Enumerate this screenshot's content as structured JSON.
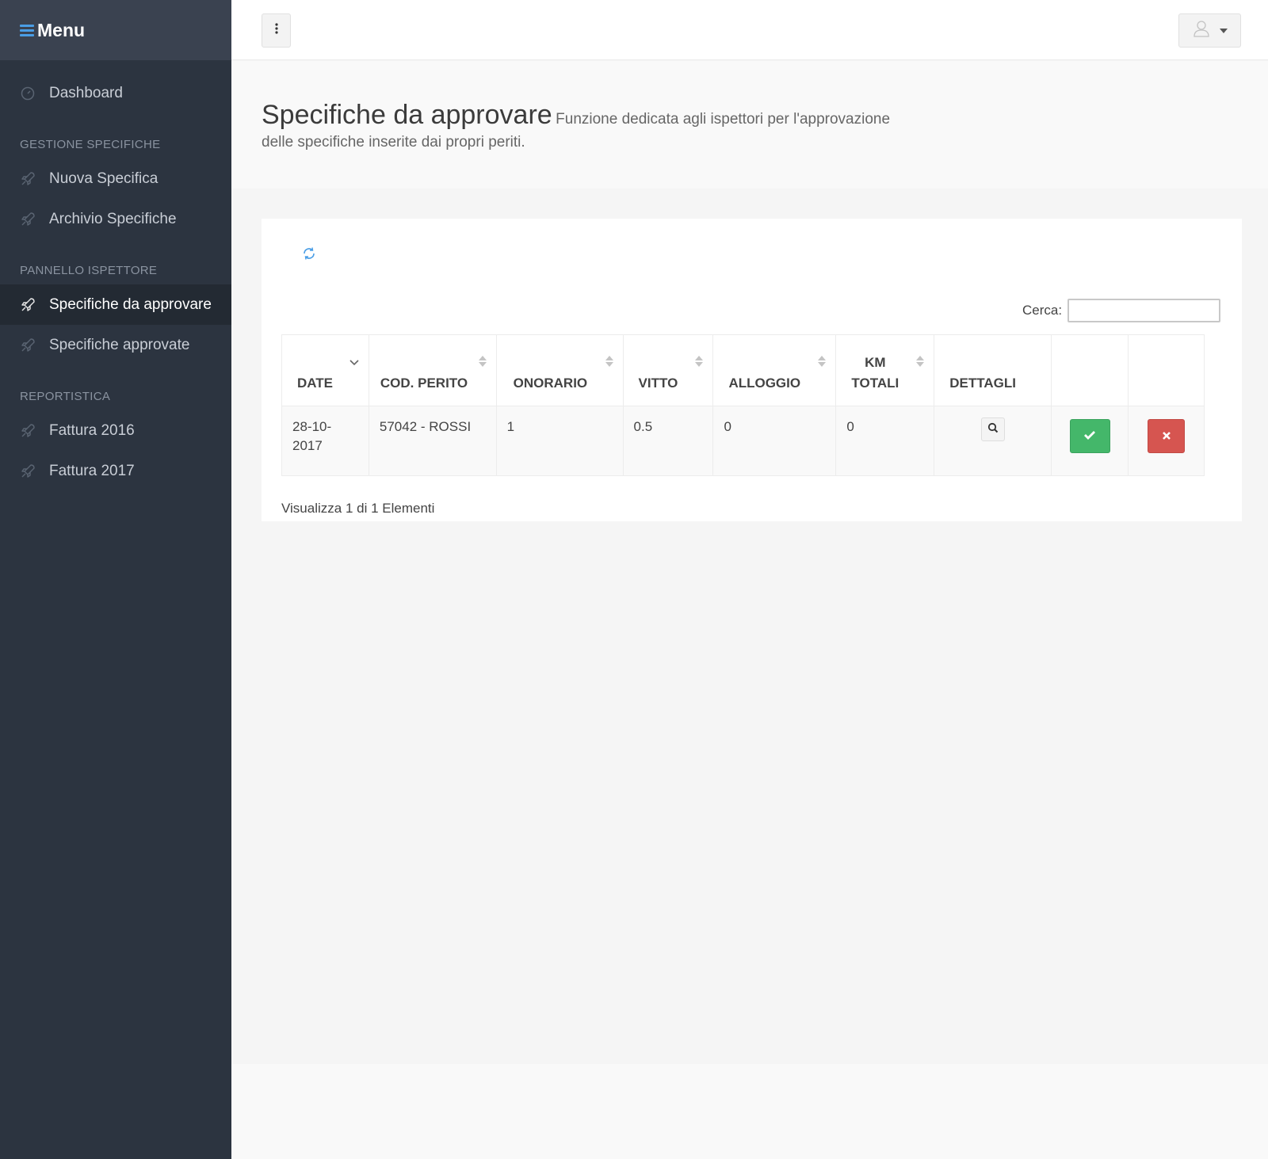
{
  "sidebar": {
    "title": "Menu",
    "items": [
      {
        "label": "Dashboard",
        "icon": "dashboard-icon"
      },
      {
        "label": "Nuova Specifica",
        "icon": "rocket-icon"
      },
      {
        "label": "Archivio Specifiche",
        "icon": "rocket-icon"
      },
      {
        "label": "Specifiche da approvare",
        "icon": "rocket-icon",
        "active": true
      },
      {
        "label": "Specifiche approvate",
        "icon": "rocket-icon"
      },
      {
        "label": "Fattura 2016",
        "icon": "rocket-icon"
      },
      {
        "label": "Fattura 2017",
        "icon": "rocket-icon"
      }
    ],
    "sections": [
      "GESTIONE SPECIFICHE",
      "PANNELLO ISPETTORE",
      "REPORTISTICA"
    ]
  },
  "header": {
    "title": "Specifiche da approvare",
    "subtitle_line1": "Funzione dedicata agli ispettori per l'approvazione",
    "subtitle_line2": "delle specifiche inserite dai propri periti."
  },
  "search": {
    "label": "Cerca:",
    "value": "",
    "placeholder": ""
  },
  "table": {
    "columns": [
      "DATE",
      "COD. PERITO",
      "ONORARIO",
      "VITTO",
      "ALLOGGIO",
      "KM",
      "TOTALI",
      "DETTAGLI"
    ],
    "rows": [
      {
        "date_a": "28-10-",
        "date_b": "2017",
        "cod_perito": "57042 - ROSSI",
        "onorario": "1",
        "vitto": "0.5",
        "alloggio": "0",
        "km_totali": "0"
      }
    ]
  },
  "info": "Visualizza 1 di 1 Elementi",
  "colors": {
    "sidebar_bg": "#2c3440",
    "accent": "#4a9ee6",
    "approve": "#44b76a",
    "reject": "#d65550"
  }
}
